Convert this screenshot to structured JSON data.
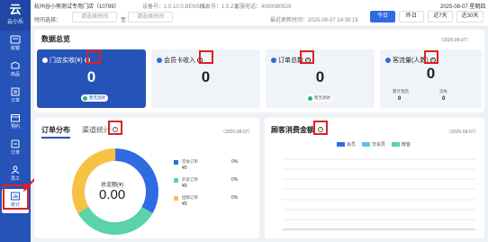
{
  "colors": {
    "primary": "#2553b8",
    "accent": "#2f6be0",
    "highlight": "#e02020",
    "green": "#2bb46b",
    "cyan": "#59c7e8",
    "teal": "#5ad3a8",
    "orange": "#f0a030"
  },
  "sidebar": {
    "logo_glyph": "云",
    "logo_sub": "云小乐",
    "items": [
      {
        "label": "收银",
        "icon": "cashier-icon"
      },
      {
        "label": "商品",
        "icon": "goods-icon"
      },
      {
        "label": "订单",
        "icon": "order-icon"
      },
      {
        "label": "预约",
        "icon": "calendar-icon"
      },
      {
        "label": "订单",
        "icon": "order2-icon"
      },
      {
        "label": "员工",
        "icon": "staff-icon"
      },
      {
        "label": "统计",
        "icon": "stats-icon"
      }
    ]
  },
  "header": {
    "store_name": "杭州谷小熊测试专用门店（10799）",
    "device_no": "设备号：1.0.10.0.BENSHU",
    "version": "版本号：1.5.2.1",
    "hotline": "客服电话：4000080629",
    "datetime": "2025-08-07 星期四",
    "time_select_label": "时间选择：",
    "date_start_placeholder": "请选择时间",
    "date_to": "至",
    "date_end_placeholder": "请选择时间",
    "last_update": "最近更新时间：2025-08-07 14:38:19",
    "quick_ranges": [
      "今日",
      "昨日",
      "近7天",
      "近30天"
    ]
  },
  "overview": {
    "title": "数据总览",
    "date": "（2025-08-07）",
    "cards": [
      {
        "label": "门店实收(¥)",
        "value": "0",
        "badge": "暂无退款"
      },
      {
        "label": "会员卡收入",
        "value": "0",
        "badge": ""
      },
      {
        "label": "订单总数",
        "value": "0",
        "badge": "暂无退款"
      },
      {
        "label": "客流量(人数)",
        "value": "0",
        "sub_labels": [
          "累计到店",
          "流失"
        ],
        "sub_values": [
          "0",
          "0"
        ]
      }
    ]
  },
  "order_panel": {
    "tabs": [
      "订单分布",
      "渠道统计"
    ],
    "date": "（2025-08-07）",
    "center_label": "总金额(¥)",
    "center_value": "0.00",
    "legend": [
      {
        "name": "堂食订单",
        "value": "¥0",
        "pct": "0%"
      },
      {
        "name": "外卖订单",
        "value": "¥0",
        "pct": "0%"
      },
      {
        "name": "团购订单",
        "value": "¥0",
        "pct": "0%"
      }
    ]
  },
  "chart_data": {
    "type": "bar",
    "title": "顾客消费金额",
    "date": "（2025-08-07）",
    "series": [
      {
        "name": "会员",
        "values": []
      },
      {
        "name": "非会员",
        "values": []
      },
      {
        "name": "散客",
        "values": []
      }
    ],
    "categories": [],
    "grid": true,
    "legend_position": "top"
  }
}
